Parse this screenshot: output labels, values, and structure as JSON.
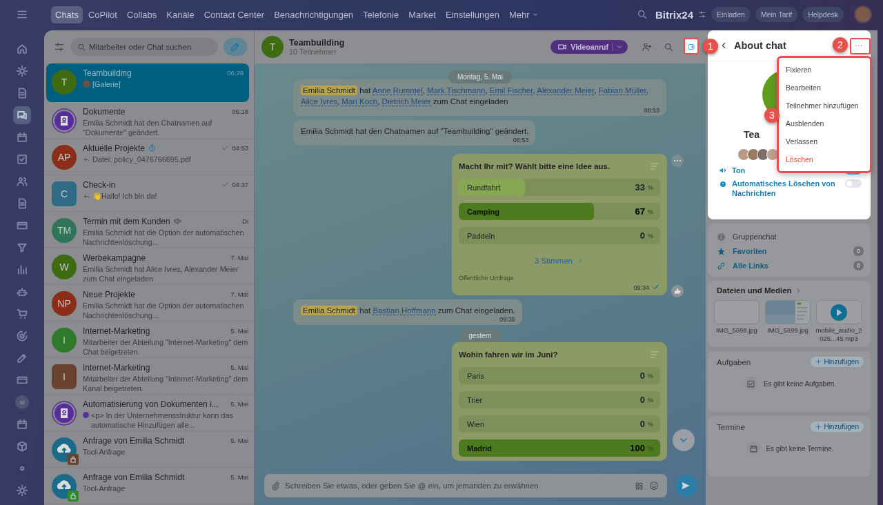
{
  "top_nav": {
    "tabs": [
      {
        "label": "Chats",
        "selected": true,
        "caret": false
      },
      {
        "label": "CoPilot",
        "selected": false,
        "caret": false
      },
      {
        "label": "Collabs",
        "selected": false,
        "caret": false
      },
      {
        "label": "Kanäle",
        "selected": false,
        "caret": false
      },
      {
        "label": "Contact Center",
        "selected": false,
        "caret": false
      },
      {
        "label": "Benachrichtigungen",
        "selected": false,
        "caret": false
      },
      {
        "label": "Telefonie",
        "selected": false,
        "caret": false
      },
      {
        "label": "Market",
        "selected": false,
        "caret": false
      },
      {
        "label": "Einstellungen",
        "selected": false,
        "caret": false
      },
      {
        "label": "Mehr",
        "selected": false,
        "caret": true
      }
    ],
    "brand": "Bitrix24",
    "buttons": [
      "Einladen",
      "Mein Tarif",
      "Helpdesk"
    ]
  },
  "rail": [
    {
      "selected": false
    },
    {
      "selected": false
    },
    {
      "selected": false
    },
    {
      "selected": true
    },
    {
      "selected": false
    },
    {
      "selected": false
    },
    {
      "selected": false
    },
    {
      "selected": false
    },
    {
      "selected": false
    },
    {
      "selected": false
    },
    {
      "selected": false
    },
    {
      "selected": false
    },
    {
      "selected": false
    },
    {
      "selected": false
    },
    {
      "selected": false
    },
    {
      "selected": false
    },
    {
      "selected": false,
      "initials": "SI"
    },
    {
      "selected": false
    },
    {
      "selected": false
    },
    {
      "selected": false
    },
    {
      "selected": false
    }
  ],
  "chat_list": {
    "search": {
      "placeholder": "Mitarbeiter oder Chat suchen"
    },
    "items": [
      {
        "name": "Teambuilding",
        "time": "06:29",
        "preview": "[Galerie]",
        "preview_mark": {
          "kind": "avatar"
        },
        "avatar": {
          "kind": "circle",
          "initials": "T",
          "color": "#3f6b12"
        },
        "selected": true,
        "read": false,
        "muted": false,
        "timer": false,
        "reply": false
      },
      {
        "name": "Dokumente",
        "time": "05:18",
        "preview": "Emilia Schmidt hat den Chatnamen auf \"Dokumente\" geändert.",
        "avatar": {
          "kind": "doc",
          "color": "#5a2e9a"
        },
        "selected": false,
        "read": false,
        "muted": false,
        "timer": false,
        "reply": false
      },
      {
        "name": "Aktuelle Projekte",
        "time": "04:53",
        "preview": "Datei: policy_0476766695.pdf",
        "avatar": {
          "kind": "circle",
          "initials": "AP",
          "color": "#8a2e1a"
        },
        "selected": false,
        "read": true,
        "muted": false,
        "timer": true,
        "reply": true
      },
      {
        "name": "Check-in",
        "time": "04:37",
        "preview": "👋Hallo! Ich bin da!",
        "avatar": {
          "kind": "square",
          "initials": "C",
          "color": "#2f6b85"
        },
        "selected": false,
        "read": true,
        "muted": false,
        "timer": false,
        "reply": true
      },
      {
        "name": "Termin mit dem Kunden",
        "time": "Di",
        "preview": "Emilia Schmidt hat die Option der automatischen Nachrichtenlöschung...",
        "avatar": {
          "kind": "circle",
          "initials": "TM",
          "color": "#2f7358"
        },
        "selected": false,
        "read": false,
        "muted": true,
        "timer": false,
        "reply": false
      },
      {
        "name": "Werbekampagne",
        "time": "7. Mai",
        "preview": "Emilia Schmidt hat Alice Ivres, Alexander Meier zum Chat eingeladen",
        "avatar": {
          "kind": "circle",
          "initials": "W",
          "color": "#3e6a12"
        },
        "selected": false,
        "read": false,
        "muted": false,
        "timer": false,
        "reply": false
      },
      {
        "name": "Neue Projekte",
        "time": "7. Mai",
        "preview": "Emilia Schmidt hat die Option der automatischen Nachrichtenlöschung...",
        "avatar": {
          "kind": "circle",
          "initials": "NP",
          "color": "#8a2e1a"
        },
        "selected": false,
        "read": false,
        "muted": false,
        "timer": false,
        "reply": false
      },
      {
        "name": "Internet-Marketing",
        "time": "5. Mai",
        "preview": "Mitarbeiter der Abteilung \"Internet-Marketing\" dem Chat beigetreten.",
        "avatar": {
          "kind": "circle",
          "initials": "I",
          "color": "#2f7a2a"
        },
        "selected": false,
        "read": false,
        "muted": false,
        "timer": false,
        "reply": false
      },
      {
        "name": "Internet-Marketing",
        "time": "5. Mai",
        "preview": "Mitarbeiter der Abteilung \"Internet-Marketing\" dem Kanal beigetreten.",
        "avatar": {
          "kind": "square",
          "initials": "I",
          "color": "#6a4330"
        },
        "selected": false,
        "read": false,
        "muted": false,
        "timer": false,
        "reply": false
      },
      {
        "name": "Automatisierung von Dokumenten i...",
        "time": "5. Mai",
        "preview": "<p> In der Unternehmensstruktur kann das automatische Hinzufügen alle...",
        "preview_mark": {
          "kind": "dot"
        },
        "avatar": {
          "kind": "doc",
          "color": "#5a2e9a"
        },
        "selected": false,
        "read": false,
        "muted": false,
        "timer": false,
        "reply": false
      },
      {
        "name": "Anfrage von Emilia Schmidt",
        "time": "5. Mai",
        "preview": "Tool-Anfrage",
        "avatar": {
          "kind": "cloud",
          "color": "#1a6b8a",
          "lock": {
            "color": "#6a4330"
          }
        },
        "selected": false,
        "read": false,
        "muted": false,
        "timer": false,
        "reply": false
      },
      {
        "name": "Anfrage von Emilia Schmidt",
        "time": "5. Mai",
        "preview": "Tool-Anfrage",
        "avatar": {
          "kind": "cloud",
          "color": "#1a6b8a",
          "lock": {
            "color": "#2f8a2a"
          }
        },
        "selected": false,
        "read": false,
        "muted": false,
        "timer": false,
        "reply": false
      }
    ]
  },
  "chat": {
    "title": "Teambuilding",
    "subtitle": "10 Teilnehmer",
    "avatar": "T",
    "video_button": "Videoanruf",
    "messages": [
      {
        "kind": "date",
        "text": "Montag, 5. Mai"
      },
      {
        "kind": "invite",
        "actor": "Emilia Schmidt",
        "verb": "hat",
        "people": [
          {
            "name": "Anne Rummel",
            "sep": ","
          },
          {
            "name": "Mark Tischmann",
            "sep": ","
          },
          {
            "name": "Emil Fischer",
            "sep": ","
          },
          {
            "name": "Alexander Meier",
            "sep": ","
          },
          {
            "name": "Fabian Müller",
            "sep": ","
          },
          {
            "name": "Alice Ivres",
            "sep": ","
          },
          {
            "name": "Mari Koch",
            "sep": ","
          },
          {
            "name": "Dietrich Meier"
          }
        ],
        "tail": "zum Chat eingeladen",
        "time": "08:53"
      },
      {
        "kind": "text",
        "text": "Emilia Schmidt hat den Chatnamen auf \"Teambuilding\" geändert.",
        "time": "08:53"
      },
      {
        "kind": "poll",
        "question": "Macht Ihr mit? Wählt bitte eine Idee aus.",
        "sign": "%",
        "options": [
          {
            "label": "Rundfahrt",
            "percent": "33",
            "level": 0.33,
            "selected": false
          },
          {
            "label": "Camping",
            "percent": "67",
            "level": 0.67,
            "selected": true
          },
          {
            "label": "Paddeln",
            "percent": "0",
            "selected": false
          }
        ],
        "votes": "3 Stimmen",
        "footer": "Öffentliche Umfrage",
        "time": "09:34"
      },
      {
        "kind": "invite",
        "actor": "Emilia Schmidt",
        "verb": "hat",
        "people": [
          {
            "name": "Bastian Hoffmann"
          }
        ],
        "tail": "zum Chat eingeladen.",
        "time": "09:35"
      },
      {
        "kind": "date",
        "text": "gestern"
      },
      {
        "kind": "poll",
        "question": "Wohin fahren wir im Juni?",
        "sign": "%",
        "options": [
          {
            "label": "Paris",
            "percent": "0",
            "selected": false
          },
          {
            "label": "Trier",
            "percent": "0",
            "selected": false
          },
          {
            "label": "Wien",
            "percent": "0",
            "selected": false
          },
          {
            "label": "Madrid",
            "percent": "100",
            "level": 1,
            "selected": true
          }
        ]
      }
    ],
    "input": {
      "placeholder": "Schreiben Sie etwas, oder geben Sie @ ein, um jemanden zu erwähnen"
    }
  },
  "about": {
    "title": "About chat",
    "name": "Tea",
    "settings": [
      {
        "label": "Ton",
        "on": true,
        "kind": "sound"
      },
      {
        "label": "Automatisches Löschen von Nachrichten",
        "on": false,
        "kind": "timer"
      }
    ]
  },
  "menu": [
    {
      "label": "Fixieren",
      "danger": false
    },
    {
      "label": "Bearbeiten",
      "danger": false
    },
    {
      "label": "Teilnehmer hinzufügen",
      "danger": false
    },
    {
      "label": "Ausblenden",
      "danger": false
    },
    {
      "label": "Verlassen",
      "danger": false
    },
    {
      "label": "Löschen",
      "danger": true
    }
  ],
  "info": {
    "type": "Gruppenchat",
    "links": [
      {
        "label": "Favoriten",
        "count": "0",
        "kind": "star"
      },
      {
        "label": "Alle Links",
        "count": "0",
        "kind": "link"
      }
    ]
  },
  "files": {
    "title": "Dateien und Medien",
    "items": [
      {
        "name": "IMG_5698.jpg",
        "kind": "blank"
      },
      {
        "name": "IMG_5699.jpg",
        "kind": "picture"
      },
      {
        "name": "mobile_audio_2025...45.mp3",
        "kind": "audio"
      }
    ]
  },
  "sections": [
    {
      "title": "Aufgaben",
      "add": "Hinzufügen",
      "empty": "Es gibt keine Aufgaben.",
      "kind": "task"
    },
    {
      "title": "Termine",
      "add": "Hinzufügen",
      "empty": "Es gibt keine Termine.",
      "kind": "event"
    }
  ],
  "markers": [
    {
      "label": "1"
    },
    {
      "label": "2"
    },
    {
      "label": "3"
    }
  ]
}
